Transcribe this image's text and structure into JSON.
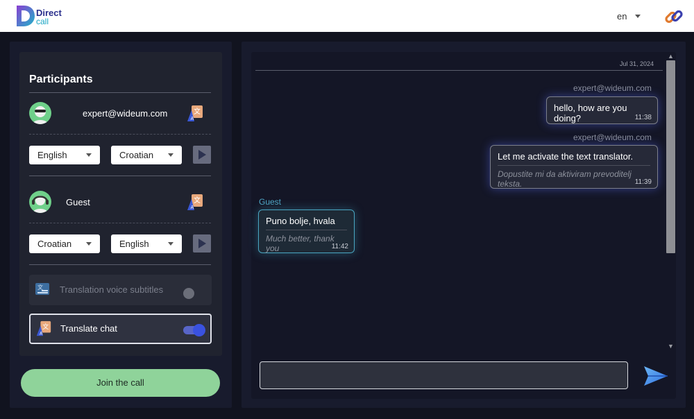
{
  "header": {
    "brand_line1": "Direct",
    "brand_line2": "call",
    "language": "en"
  },
  "participants_panel": {
    "title": "Participants",
    "participants": [
      {
        "name": "expert@wideum.com",
        "from_language": "English",
        "to_language": "Croatian"
      },
      {
        "name": "Guest",
        "from_language": "Croatian",
        "to_language": "English"
      }
    ],
    "toggles": [
      {
        "label": "Translation voice subtitles",
        "enabled": false
      },
      {
        "label": "Translate chat",
        "enabled": true
      }
    ],
    "join_label": "Join the call"
  },
  "chat": {
    "date": "Jul 31, 2024",
    "messages": [
      {
        "sender": "expert@wideum.com",
        "text": "hello, how are you doing?",
        "translation": "",
        "time": "11:38",
        "direction": "outgoing"
      },
      {
        "sender": "expert@wideum.com",
        "text": "Let me activate the text translator.",
        "translation": "Dopustite mi da aktiviram prevoditelj teksta.",
        "time": "11:39",
        "direction": "outgoing"
      },
      {
        "sender": "Guest",
        "text": "Puno bolje, hvala",
        "translation": "Much better, thank you",
        "time": "11:42",
        "direction": "incoming"
      }
    ],
    "input_value": "",
    "input_placeholder": ""
  },
  "icons": {
    "logo": "direct-call-logo",
    "header_right": "link-icon",
    "translate": "translate-icon",
    "subtitles": "subtitles-icon",
    "play": "play-icon",
    "send": "send-icon"
  },
  "colors": {
    "accent_blue": "#3a52e0",
    "join_green": "#8fd39a",
    "guest_cyan": "#4fa6c5",
    "background": "#11131f"
  }
}
